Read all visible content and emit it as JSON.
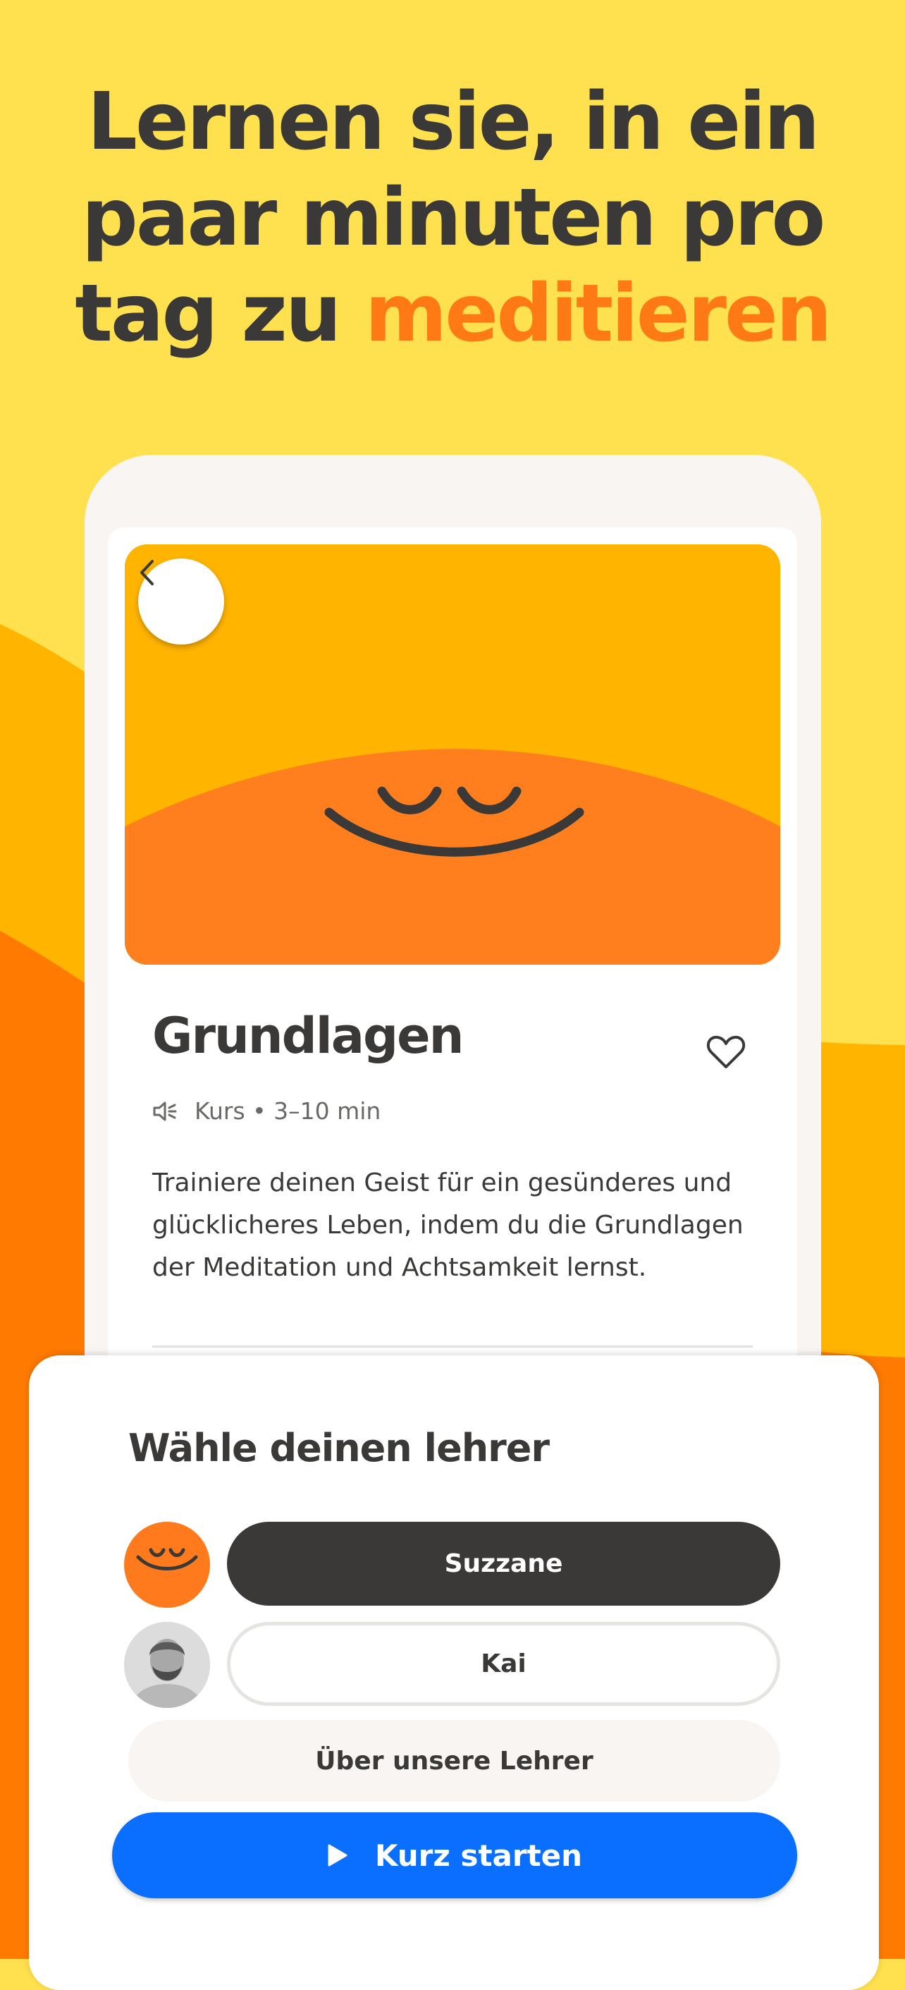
{
  "headline": {
    "line1": "Lernen sie, in ein",
    "line2": "paar minuten pro",
    "line3_prefix": "tag zu ",
    "line3_accent": "meditieren"
  },
  "course": {
    "title": "Grundlagen",
    "meta": "Kurs • 3–10 min",
    "description": "Trainiere deinen Geist für ein gesünderes und glücklicheres Leben, indem du die Grundlagen der Meditation und Achtsamkeit lernst."
  },
  "sheet": {
    "title": "Wähle deinen lehrer",
    "teachers": [
      {
        "name": "Suzzane",
        "selected": true
      },
      {
        "name": "Kai",
        "selected": false
      }
    ],
    "about_label": "Über unsere Lehrer",
    "start_label": "Kurz starten"
  },
  "icons": {
    "back": "chevron-left-icon",
    "favorite": "heart-icon",
    "audio": "speaker-icon",
    "play": "play-icon"
  },
  "colors": {
    "background_yellow": "#FFE04E",
    "hero_yellow": "#FFB400",
    "accent_orange": "#FF7A14",
    "text_dark": "#3A3937",
    "primary_blue": "#0A6FFF"
  }
}
